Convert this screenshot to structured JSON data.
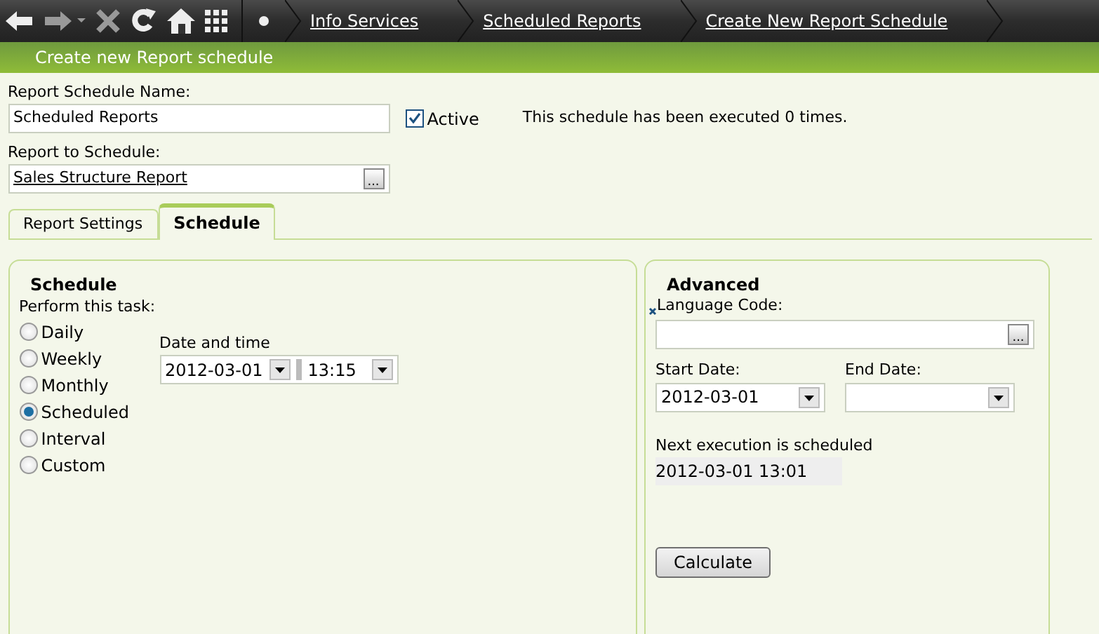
{
  "toolbar": {
    "breadcrumbs": [
      {
        "label": "Info Services"
      },
      {
        "label": "Scheduled Reports"
      },
      {
        "label": "Create New Report Schedule"
      }
    ]
  },
  "header": {
    "title": "Create new Report schedule"
  },
  "form": {
    "name_label": "Report Schedule Name:",
    "name_value": "Scheduled Reports",
    "active": {
      "label": "Active",
      "checked": true
    },
    "execution_note": "This schedule has been executed 0 times.",
    "report_label": "Report to Schedule:",
    "report_value": "Sales Structure Report",
    "browse_button": "..."
  },
  "tabs": [
    {
      "label": "Report Settings",
      "selected": false
    },
    {
      "label": "Schedule",
      "selected": true
    }
  ],
  "schedule": {
    "legend": "Schedule",
    "prompt": "Perform this task:",
    "options": [
      {
        "label": "Daily",
        "selected": false
      },
      {
        "label": "Weekly",
        "selected": false
      },
      {
        "label": "Monthly",
        "selected": false
      },
      {
        "label": "Scheduled",
        "selected": true
      },
      {
        "label": "Interval",
        "selected": false
      },
      {
        "label": "Custom",
        "selected": false
      }
    ],
    "datetime_label": "Date and time",
    "date": "2012-03-01",
    "time": "13:15"
  },
  "advanced": {
    "legend": "Advanced",
    "language_label": "Language Code:",
    "language_browse": "...",
    "start_label": "Start Date:",
    "start_value": "2012-03-01",
    "end_label": "End Date:",
    "next_label": "Next execution is scheduled",
    "next_value": "2012-03-01 13:01",
    "calculate_button": "Calculate"
  }
}
